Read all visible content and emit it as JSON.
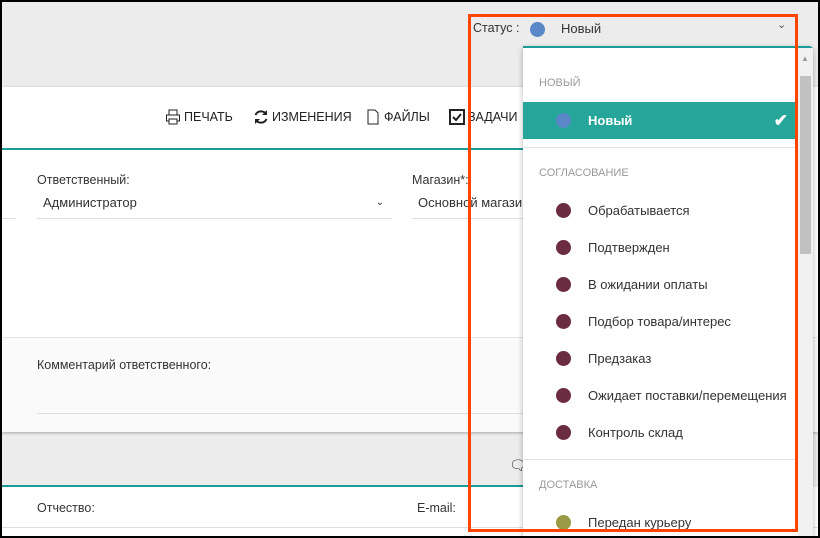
{
  "status": {
    "label": "Статус :",
    "value": "Новый",
    "color": "#5a87c8"
  },
  "toolbar": {
    "print": "ПЕЧАТЬ",
    "changes": "ИЗМЕНЕНИЯ",
    "files": "ФАЙЛЫ",
    "tasks": "ЗАДАЧИ"
  },
  "form": {
    "responsible_label": "Ответственный:",
    "responsible_value": "Администратор",
    "shop_label": "Магазин*:",
    "shop_value": "Основной магазин",
    "comment_label": "Комментарий ответственного:",
    "patronymic_label": "Отчество:",
    "email_label": "E-mail:"
  },
  "dropdown": {
    "groups": [
      {
        "title": "Новый",
        "items": [
          {
            "label": "Новый",
            "color": "#5a87c8",
            "selected": true
          }
        ]
      },
      {
        "title": "Согласование",
        "items": [
          {
            "label": "Обрабатывается",
            "color": "#6b2c42"
          },
          {
            "label": "Подтвержден",
            "color": "#6b2c42"
          },
          {
            "label": "В ожидании оплаты",
            "color": "#6b2c42"
          },
          {
            "label": "Подбор товара/интерес",
            "color": "#6b2c42"
          },
          {
            "label": "Предзаказ",
            "color": "#6b2c42"
          },
          {
            "label": "Ожидает поставки/перемещения",
            "color": "#6b2c42"
          },
          {
            "label": "Контроль склад",
            "color": "#6b2c42"
          }
        ]
      },
      {
        "title": "Доставка",
        "items": [
          {
            "label": "Передан курьеру",
            "color": "#9a9a45"
          }
        ]
      }
    ]
  },
  "colors": {
    "accent": "#26a69a",
    "highlight": "#ff4500"
  }
}
